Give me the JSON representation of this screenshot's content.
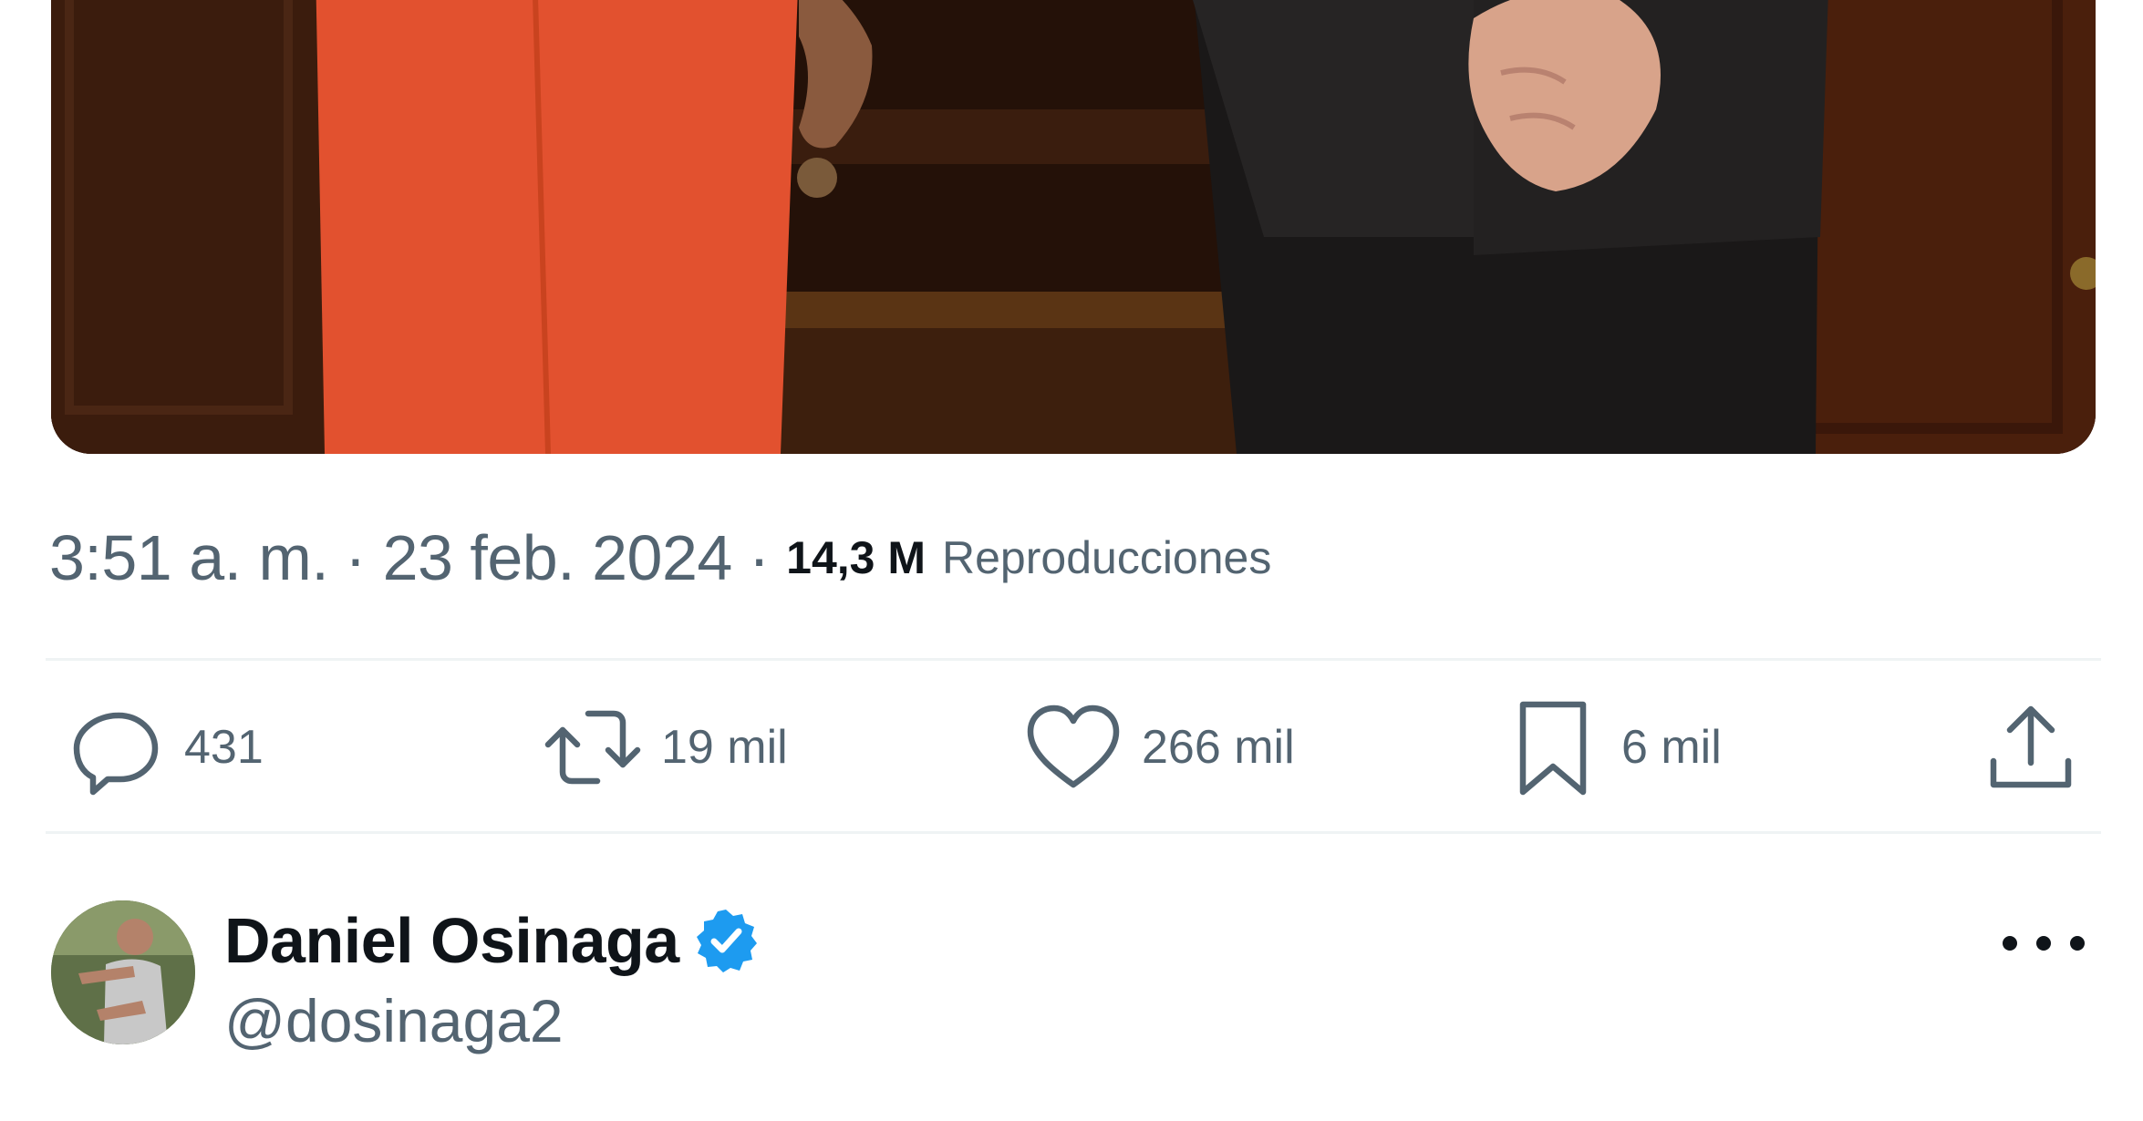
{
  "tweet": {
    "time": "3:51 a. m.",
    "separator": "·",
    "date": "23 feb. 2024",
    "views_count": "14,3 M",
    "views_label": "Reproducciones"
  },
  "actions": {
    "replies": {
      "icon": "reply-icon",
      "count": "431"
    },
    "retweets": {
      "icon": "retweet-icon",
      "count": "19 mil"
    },
    "likes": {
      "icon": "heart-icon",
      "count": "266 mil"
    },
    "bookmarks": {
      "icon": "bookmark-icon",
      "count": "6 mil"
    },
    "share": {
      "icon": "share-icon"
    }
  },
  "author": {
    "name": "Daniel Osinaga",
    "handle": "@dosinaga2",
    "verified": true,
    "verified_color": "#1d9bf0"
  },
  "colors": {
    "secondary_text": "#536471",
    "primary_text": "#0f1419",
    "divider": "#eff3f4"
  }
}
